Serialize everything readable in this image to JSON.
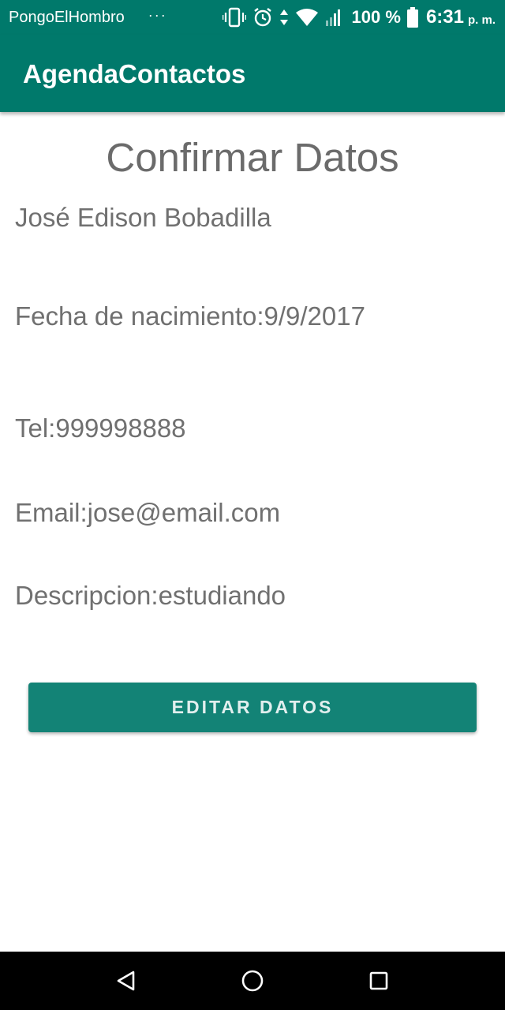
{
  "status_bar": {
    "carrier": "PongoElHombro",
    "dots": "···",
    "battery_percent": "100 %",
    "time": "6:31",
    "ampm": "p. m.",
    "icons": [
      "vibrate-icon",
      "alarm-icon",
      "data-arrows-icon",
      "wifi-icon",
      "signal-icon",
      "battery-icon"
    ]
  },
  "app_bar": {
    "title": "AgendaContactos"
  },
  "main": {
    "heading": "Confirmar Datos",
    "name": "José Edison Bobadilla",
    "birth": "Fecha de nacimiento:9/9/2017",
    "phone": "Tel:999998888",
    "email": "Email:jose@email.com",
    "description": "Descripcion:estudiando",
    "edit_button_label": "EDITAR DATOS"
  },
  "nav_bar": {
    "icons": [
      "back-icon",
      "home-icon",
      "recents-icon"
    ]
  },
  "colors": {
    "primary": "#00796b",
    "text": "#707070",
    "nav": "#000000"
  }
}
